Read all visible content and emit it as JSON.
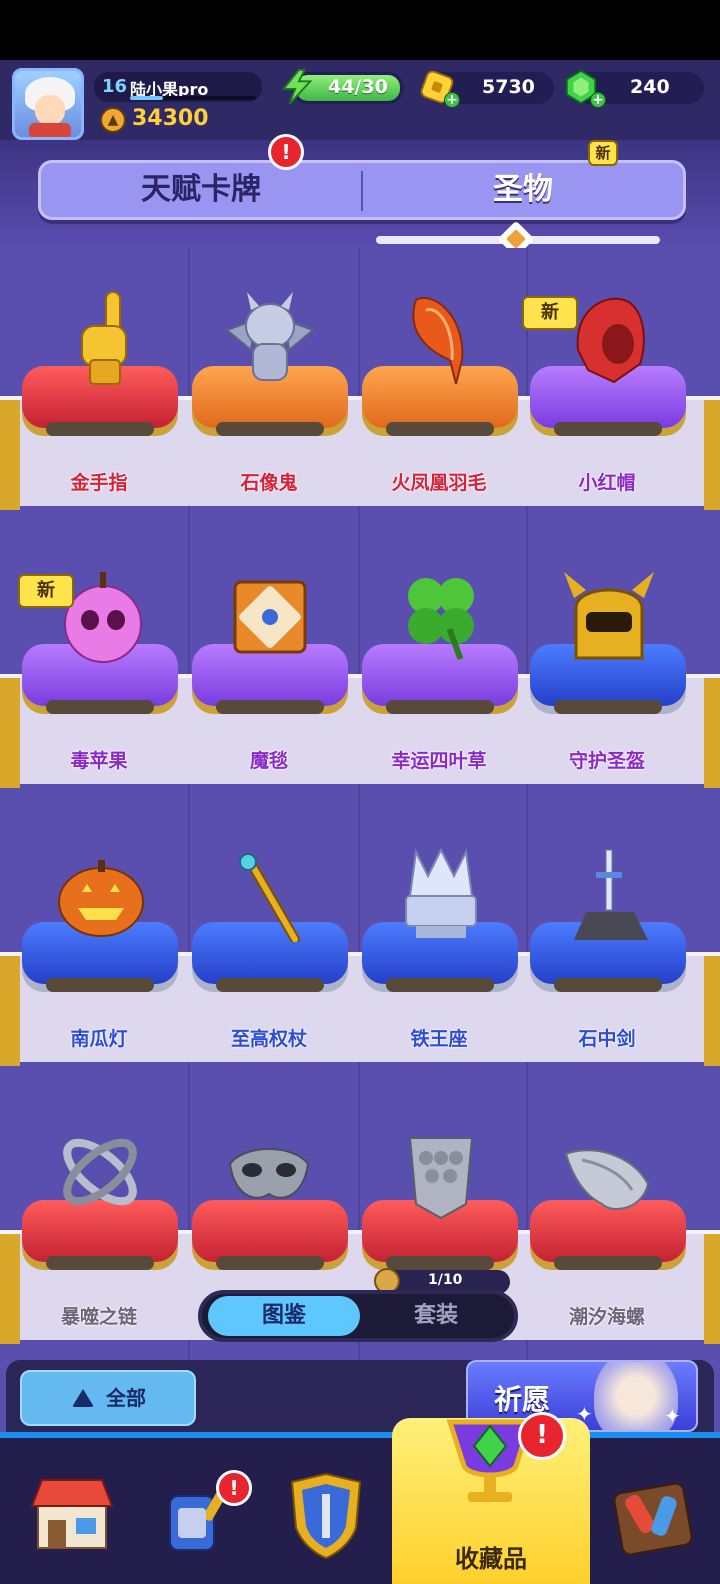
{
  "player": {
    "level": "16",
    "name": "陆小果pro",
    "xp_fraction": 0.26,
    "trophies": "34300"
  },
  "resources": {
    "energy": "44/30",
    "gold": "5730",
    "gems": "240"
  },
  "tabs": {
    "talent_cards": "天赋卡牌",
    "relics": "圣物",
    "alert_mark": "!",
    "new_tag": "新"
  },
  "relics": [
    {
      "name": "金手指",
      "cushion": "red",
      "label_color": "red",
      "is_new": false
    },
    {
      "name": "石像鬼",
      "cushion": "orange",
      "label_color": "red",
      "is_new": false
    },
    {
      "name": "火凤凰羽毛",
      "cushion": "orange",
      "label_color": "red",
      "is_new": false
    },
    {
      "name": "小红帽",
      "cushion": "purple",
      "label_color": "purple",
      "is_new": true
    },
    {
      "name": "毒苹果",
      "cushion": "purple",
      "label_color": "purple",
      "is_new": true
    },
    {
      "name": "魔毯",
      "cushion": "purple",
      "label_color": "purple",
      "is_new": false
    },
    {
      "name": "幸运四叶草",
      "cushion": "purple",
      "label_color": "purple",
      "is_new": false
    },
    {
      "name": "守护圣盔",
      "cushion": "blue",
      "label_color": "purple",
      "is_new": false
    },
    {
      "name": "南瓜灯",
      "cushion": "blue",
      "label_color": "blue",
      "is_new": false
    },
    {
      "name": "至高权杖",
      "cushion": "blue",
      "label_color": "blue",
      "is_new": false
    },
    {
      "name": "铁王座",
      "cushion": "blue",
      "label_color": "blue",
      "is_new": false
    },
    {
      "name": "石中剑",
      "cushion": "blue",
      "label_color": "blue",
      "is_new": false
    },
    {
      "name": "暴噬之链",
      "cushion": "red",
      "label_color": "gray",
      "is_new": false
    },
    {
      "name": "",
      "cushion": "red",
      "label_color": "gray",
      "is_new": false
    },
    {
      "name": "",
      "cushion": "red",
      "label_color": "gray",
      "is_new": false
    },
    {
      "name": "潮汐海螺",
      "cushion": "red",
      "label_color": "gray",
      "is_new": false
    }
  ],
  "new_label": "新",
  "set_progress": "1/10",
  "subtabs": {
    "catalog": "图鉴",
    "sets": "套装"
  },
  "filter": {
    "label": "全部"
  },
  "wish_button": {
    "label": "祈愿"
  },
  "bottom_nav": {
    "active_label": "收藏品",
    "items": [
      "shop-icon",
      "armory-icon",
      "shield-icon",
      "collection-icon",
      "board-icon"
    ]
  },
  "colors": {
    "accent_blue": "#5ec7ff",
    "alert_red": "#e8252e",
    "new_yellow": "#ffe34d",
    "nav_active": "#ffd93a"
  }
}
